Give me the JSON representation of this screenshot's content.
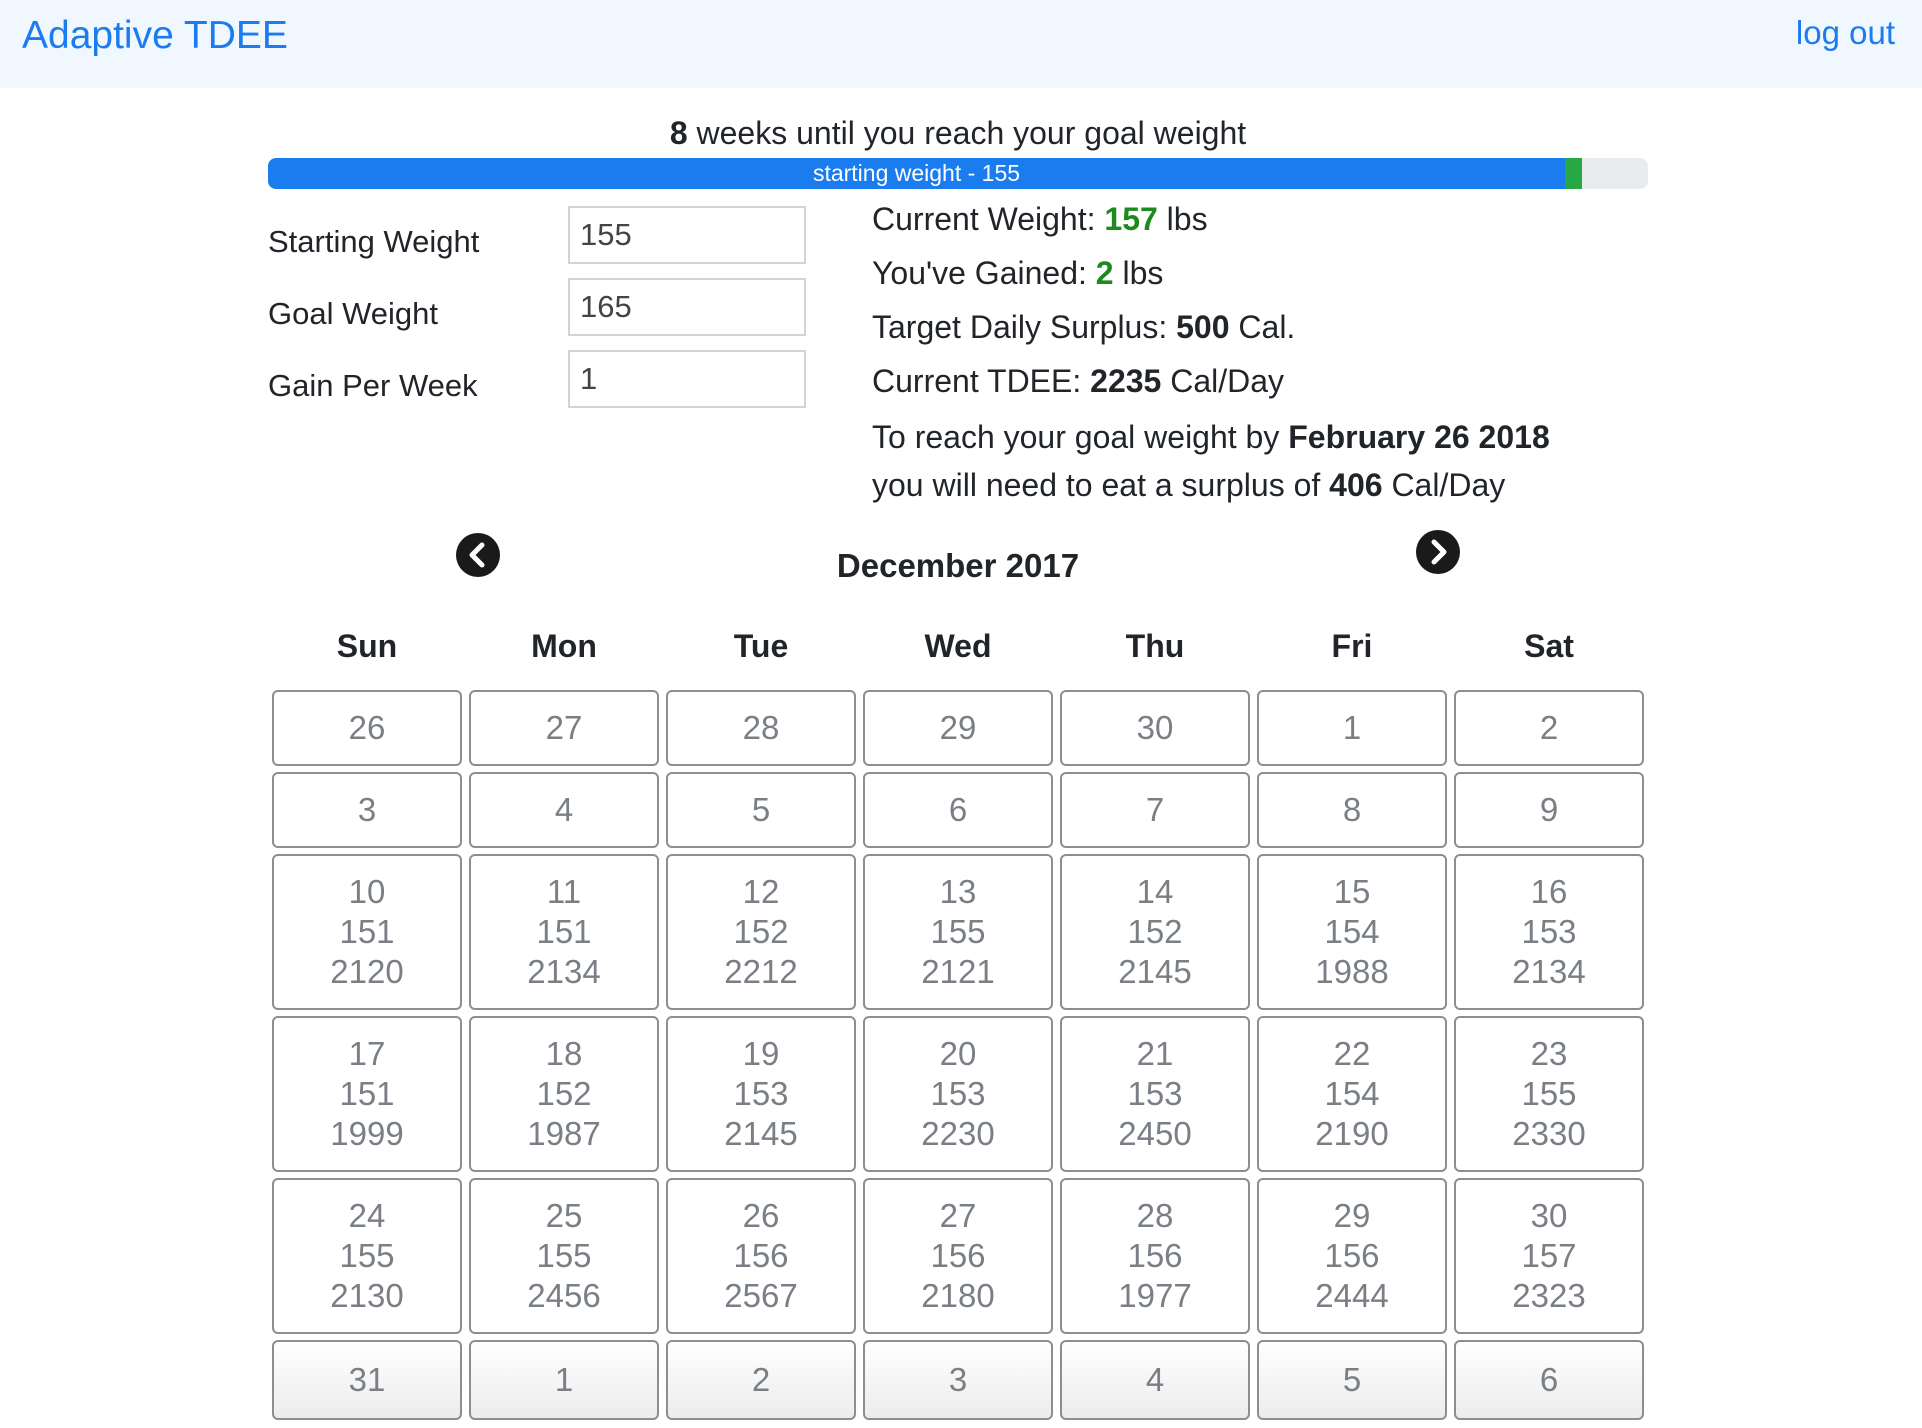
{
  "app": {
    "brand": "Adaptive TDEE",
    "logout": "log out"
  },
  "summary": {
    "weeks": "8",
    "weeks_text": " weeks until you reach your goal weight",
    "progress_label": "starting weight - 155",
    "progress_fraction": 0.94,
    "progress_gain_fraction": 0.012
  },
  "form": {
    "starting_weight_label": "Starting Weight",
    "starting_weight_value": "155",
    "goal_weight_label": "Goal Weight",
    "goal_weight_value": "165",
    "gain_per_week_label": "Gain Per Week",
    "gain_per_week_value": "1"
  },
  "stats": {
    "current_weight_label": "Current Weight: ",
    "current_weight_value": "157",
    "current_weight_unit": " lbs",
    "gained_label": "You've Gained: ",
    "gained_value": "2",
    "gained_unit": " lbs",
    "surplus_label": "Target Daily Surplus: ",
    "surplus_value": "500",
    "surplus_unit": " Cal.",
    "tdee_label": "Current TDEE: ",
    "tdee_value": "2235",
    "tdee_unit": " Cal/Day",
    "goal_text_1": "To reach your goal weight by ",
    "goal_date": "February 26 2018",
    "goal_text_2": "you will need to eat a surplus of ",
    "goal_surplus": "406",
    "goal_surplus_unit": " Cal/Day"
  },
  "calendar": {
    "title": "December 2017",
    "weekdays": [
      "Sun",
      "Mon",
      "Tue",
      "Wed",
      "Thu",
      "Fri",
      "Sat"
    ],
    "weeks": [
      [
        [
          "26"
        ],
        [
          "27"
        ],
        [
          "28"
        ],
        [
          "29"
        ],
        [
          "30"
        ],
        [
          "1"
        ],
        [
          "2"
        ]
      ],
      [
        [
          "3"
        ],
        [
          "4"
        ],
        [
          "5"
        ],
        [
          "6"
        ],
        [
          "7"
        ],
        [
          "8"
        ],
        [
          "9"
        ]
      ],
      [
        [
          "10",
          "151",
          "2120"
        ],
        [
          "11",
          "151",
          "2134"
        ],
        [
          "12",
          "152",
          "2212"
        ],
        [
          "13",
          "155",
          "2121"
        ],
        [
          "14",
          "152",
          "2145"
        ],
        [
          "15",
          "154",
          "1988"
        ],
        [
          "16",
          "153",
          "2134"
        ]
      ],
      [
        [
          "17",
          "151",
          "1999"
        ],
        [
          "18",
          "152",
          "1987"
        ],
        [
          "19",
          "153",
          "2145"
        ],
        [
          "20",
          "153",
          "2230"
        ],
        [
          "21",
          "153",
          "2450"
        ],
        [
          "22",
          "154",
          "2190"
        ],
        [
          "23",
          "155",
          "2330"
        ]
      ],
      [
        [
          "24",
          "155",
          "2130"
        ],
        [
          "25",
          "155",
          "2456"
        ],
        [
          "26",
          "156",
          "2567"
        ],
        [
          "27",
          "156",
          "2180"
        ],
        [
          "28",
          "156",
          "1977"
        ],
        [
          "29",
          "156",
          "2444"
        ],
        [
          "30",
          "157",
          "2323"
        ]
      ],
      [
        [
          "31"
        ],
        [
          "1"
        ],
        [
          "2"
        ],
        [
          "3"
        ],
        [
          "4"
        ],
        [
          "5"
        ],
        [
          "6"
        ]
      ]
    ]
  }
}
